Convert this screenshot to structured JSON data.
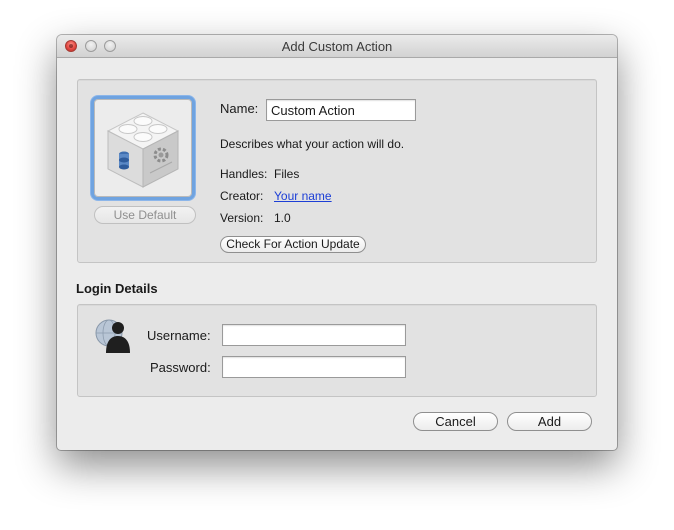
{
  "window": {
    "title": "Add Custom Action"
  },
  "action": {
    "use_default_label": "Use Default",
    "name_label": "Name:",
    "name_value": "Custom Action",
    "description": "Describes what your action will do.",
    "handles_label": "Handles:",
    "handles_value": "Files",
    "creator_label": "Creator:",
    "creator_value": "Your name",
    "version_label": "Version:",
    "version_value": "1.0",
    "update_button": "Check For Action Update"
  },
  "login": {
    "section_title": "Login Details",
    "username_label": "Username:",
    "username_value": "",
    "password_label": "Password:",
    "password_value": ""
  },
  "footer": {
    "cancel_label": "Cancel",
    "add_label": "Add"
  },
  "colors": {
    "accent_focus": "#6fa3e0",
    "link": "#1c3ed6",
    "close_button": "#e0443e"
  },
  "icons": {
    "action_icon": "lego-brick-gear-icon",
    "user_icon": "user-silhouette-globe-icon"
  }
}
